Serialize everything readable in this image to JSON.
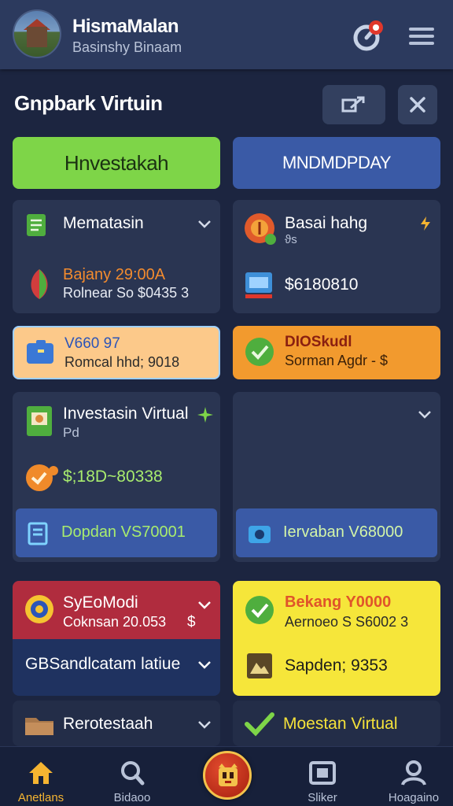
{
  "header": {
    "user_name": "HismaMalan",
    "user_subtitle": "Basinshy Binaam"
  },
  "section": {
    "title": "Gnpbark Virtuin"
  },
  "tabs": [
    {
      "label": "Hnvestakah",
      "color": "#7ed548"
    },
    {
      "label": "MNDMDPDAY",
      "color": "#3a5aa6"
    }
  ],
  "cards": {
    "c1": {
      "title": "Mematasin",
      "line1": "Bajany 29:00A",
      "line2": "Rolnear So $0435 3"
    },
    "c2": {
      "title": "Basai hahg",
      "sub": "ϑs",
      "value": "$6180810"
    },
    "c3": {
      "line1": "V660 97",
      "line2": "Romcal hhd; 9018",
      "color": "#fcc98a"
    },
    "c4": {
      "line1": "DIOSkudl",
      "line2": "Sorman Agdr - $",
      "color": "#f29a2e"
    },
    "c5": {
      "title": "Investasin Virtual",
      "sub": "Pd",
      "value": "$;18D~80338",
      "button": "Dopdan VS70001"
    },
    "c6": {
      "button": "Iervaban V68000"
    },
    "c7": {
      "title": "SyEoModi",
      "line2": "Coknsan 20.053",
      "dollar": "$",
      "sub_label": "GBSandlcatam latiue",
      "color": "#b02c3e"
    },
    "c8": {
      "title": "Bekang Y0000",
      "line2": "Aernoeo S S6002 3",
      "value": "Sapden; 9353",
      "color": "#f6e63a"
    },
    "c9": {
      "title": "Rerotestaah"
    },
    "c10": {
      "title": "Moestan Virtual"
    }
  },
  "nav": [
    {
      "label": "Anetlans",
      "icon": "home-icon",
      "active": true
    },
    {
      "label": "Bidaoo",
      "icon": "search-icon"
    },
    {
      "label": "",
      "icon": "mascot-icon"
    },
    {
      "label": "Sliker",
      "icon": "camera-icon"
    },
    {
      "label": "Hoagaino",
      "icon": "profile-icon"
    }
  ]
}
